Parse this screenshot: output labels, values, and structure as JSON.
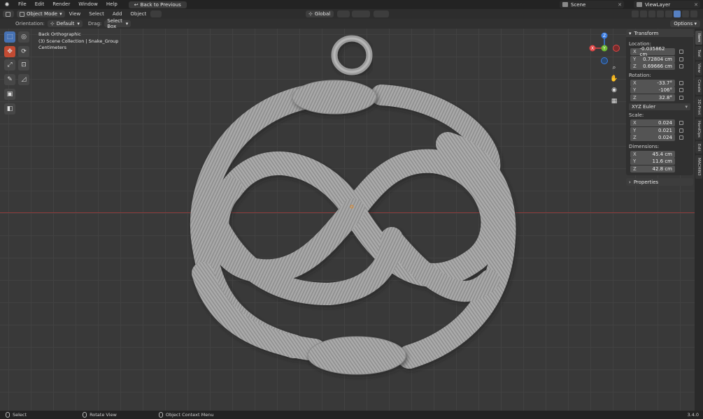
{
  "topbar": {
    "menus": [
      "File",
      "Edit",
      "Render",
      "Window",
      "Help"
    ],
    "back_button": "Back to Previous",
    "scene": "Scene",
    "view_layer": "ViewLayer"
  },
  "header": {
    "mode": "Object Mode",
    "menus": [
      "View",
      "Select",
      "Add",
      "Object"
    ],
    "transform_orientation": "Global"
  },
  "tool_settings": {
    "orientation_label": "Orientation:",
    "orientation_value": "Default",
    "drag_label": "Drag:",
    "drag_value": "Select Box",
    "options": "Options"
  },
  "viewport_info": {
    "view": "Back Orthographic",
    "collection": "(3) Scene Collection | Snake_Group",
    "units": "Centimeters"
  },
  "gizmo": {
    "z": "Z",
    "y": "Y",
    "x": "X"
  },
  "npanel": {
    "transform_header": "Transform",
    "location_label": "Location:",
    "location": {
      "x": "-0.035862 cm",
      "y": "0.72804 cm",
      "z": "0.69666 cm"
    },
    "rotation_label": "Rotation:",
    "rotation": {
      "x": "-33.7°",
      "y": "-106°",
      "z": "32.8°"
    },
    "rotation_mode": "XYZ Euler",
    "scale_label": "Scale:",
    "scale": {
      "x": "0.024",
      "y": "0.021",
      "z": "0.024"
    },
    "dimensions_label": "Dimensions:",
    "dimensions": {
      "x": "45.4 cm",
      "y": "11.6 cm",
      "z": "42.8 cm"
    },
    "properties_header": "Properties",
    "axis_x": "X",
    "axis_y": "Y",
    "axis_z": "Z"
  },
  "side_tabs": [
    "Item",
    "Tool",
    "View",
    "Create",
    "3D-Print",
    "HardOps",
    "Edit",
    "MACHIN3"
  ],
  "statusbar": {
    "left": "Select",
    "middle": "Rotate View",
    "right": "Object Context Menu",
    "version": "3.4.0"
  },
  "colors": {
    "accent_blue": "#4772b3",
    "active_tool_orange": "#c24b33",
    "axis_x": "#e04747",
    "axis_y": "#6fbb33",
    "axis_z": "#3b7ce0"
  }
}
